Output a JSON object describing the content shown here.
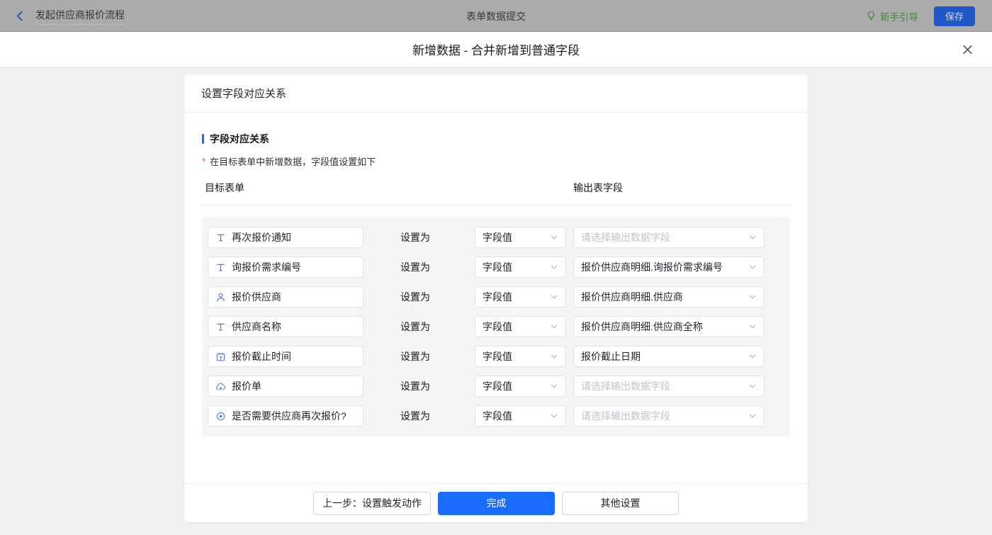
{
  "topbar": {
    "back_label": "发起供应商报价流程",
    "center_title": "表单数据提交",
    "guide_label": "新手引导",
    "save_label": "保存"
  },
  "modal": {
    "title": "新增数据 - 合并新增到普通字段"
  },
  "card": {
    "header": "设置字段对应关系",
    "section_title": "字段对应关系",
    "required_mark": "*",
    "section_desc": "在目标表单中新增数据，字段值设置如下",
    "col_target": "目标表单",
    "col_output": "输出表字段",
    "rows": [
      {
        "icon": "text-field-icon",
        "field": "再次报价通知",
        "set_as": "设置为",
        "type": "字段值",
        "output": "请选择输出数据字段",
        "placeholder": true
      },
      {
        "icon": "text-field-icon",
        "field": "询报价需求编号",
        "set_as": "设置为",
        "type": "字段值",
        "output": "报价供应商明细.询报价需求编号",
        "placeholder": false
      },
      {
        "icon": "person-icon",
        "field": "报价供应商",
        "set_as": "设置为",
        "type": "字段值",
        "output": "报价供应商明细.供应商",
        "placeholder": false
      },
      {
        "icon": "text-field-icon",
        "field": "供应商名称",
        "set_as": "设置为",
        "type": "字段值",
        "output": "报价供应商明细.供应商全称",
        "placeholder": false
      },
      {
        "icon": "calendar-icon",
        "field": "报价截止时间",
        "set_as": "设置为",
        "type": "字段值",
        "output": "报价截止日期",
        "placeholder": false
      },
      {
        "icon": "upload-icon",
        "field": "报价单",
        "set_as": "设置为",
        "type": "字段值",
        "output": "请选择输出数据字段",
        "placeholder": true
      },
      {
        "icon": "radio-icon",
        "field": "是否需要供应商再次报价?",
        "set_as": "设置为",
        "type": "字段值",
        "output": "请选择输出数据字段",
        "placeholder": true
      }
    ],
    "footer": {
      "prev_label": "上一步：设置触发动作",
      "done_label": "完成",
      "other_label": "其他设置"
    }
  },
  "colors": {
    "accent_blue": "#1a6cfa",
    "field_icon_blue": "#5e7ce0",
    "guide_green": "#44843c",
    "topbar_dimmed_bg": "#ababab",
    "panel_bg": "#f5f5f6",
    "placeholder_text": "#bfc3cb"
  }
}
